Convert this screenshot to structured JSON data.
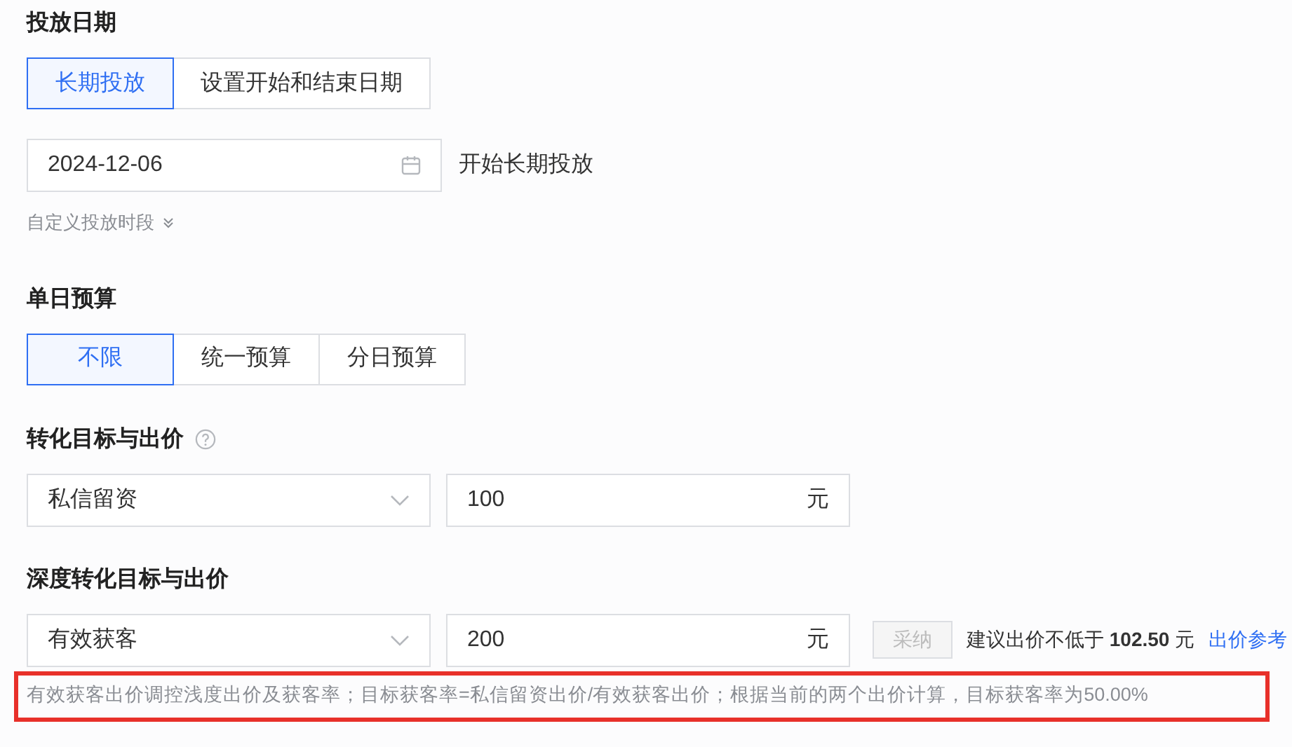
{
  "sections": [
    {
      "title": "投放日期",
      "segments": [
        {
          "label": "长期投放",
          "selected": true
        },
        {
          "label": "设置开始和结束日期",
          "selected": false
        }
      ],
      "date_field": {
        "value": "2024-12-06",
        "suffix_text": "开始长期投放"
      },
      "expand_link": {
        "label": "自定义投放时段",
        "expanded": false
      }
    },
    {
      "title": "单日预算",
      "segments": [
        {
          "label": "不限",
          "selected": true
        },
        {
          "label": "统一预算",
          "selected": false
        },
        {
          "label": "分日预算",
          "selected": false
        }
      ]
    },
    {
      "title": "转化目标与出价",
      "help": true,
      "bid_row": {
        "select": "私信留资",
        "bid": "100",
        "unit": "元"
      }
    },
    {
      "title": "深度转化目标与出价",
      "bid_row": {
        "select": "有效获客",
        "bid": "200",
        "unit": "元",
        "adopt_button": {
          "label": "采纳",
          "disabled": true
        },
        "suggestion": "建议出价不低于 **102.50** 元",
        "reference_link": "出价参考"
      },
      "note": {
        "text": "有效获客出价调控浅度出价及获客率；目标获客率=私信留资出价/有效获客出价；根据当前的两个出价计算，目标获客率为50.00%",
        "highlighted": true
      }
    }
  ]
}
